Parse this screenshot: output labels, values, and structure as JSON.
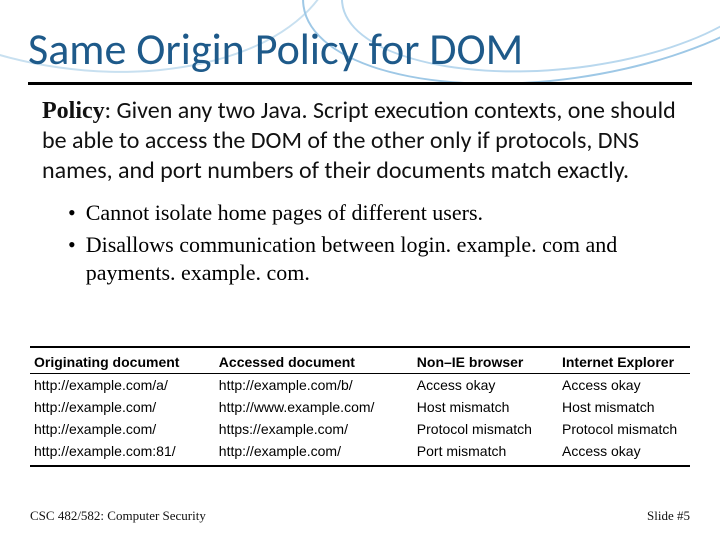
{
  "title": "Same Origin Policy for DOM",
  "policy": {
    "label": "Policy",
    "text": ": Given any two Java. Script execution contexts, one should be able to access the DOM of the other only if protocols, DNS names, and port numbers of their documents match exactly."
  },
  "bullets": [
    "Cannot isolate home pages of different users.",
    "Disallows communication between login. example. com and payments. example. com."
  ],
  "table": {
    "headers": [
      "Originating document",
      "Accessed document",
      "Non–IE browser",
      "Internet Explorer"
    ],
    "rows": [
      [
        "http://example.com/a/",
        "http://example.com/b/",
        "Access okay",
        "Access okay"
      ],
      [
        "http://example.com/",
        "http://www.example.com/",
        "Host mismatch",
        "Host mismatch"
      ],
      [
        "http://example.com/",
        "https://example.com/",
        "Protocol mismatch",
        "Protocol mismatch"
      ],
      [
        "http://example.com:81/",
        "http://example.com/",
        "Port mismatch",
        "Access okay"
      ]
    ]
  },
  "footer": {
    "left": "CSC 482/582: Computer Security",
    "right": "Slide #5"
  },
  "chart_data": {
    "type": "table",
    "title": "Same Origin Policy comparison",
    "columns": [
      "Originating document",
      "Accessed document",
      "Non–IE browser",
      "Internet Explorer"
    ],
    "rows": [
      [
        "http://example.com/a/",
        "http://example.com/b/",
        "Access okay",
        "Access okay"
      ],
      [
        "http://example.com/",
        "http://www.example.com/",
        "Host mismatch",
        "Host mismatch"
      ],
      [
        "http://example.com/",
        "https://example.com/",
        "Protocol mismatch",
        "Protocol mismatch"
      ],
      [
        "http://example.com:81/",
        "http://example.com/",
        "Port mismatch",
        "Access okay"
      ]
    ]
  }
}
